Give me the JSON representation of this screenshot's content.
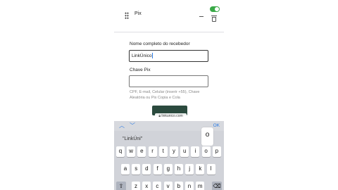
{
  "app": {
    "section_title": "Pix",
    "toggle_on": true,
    "accent_color": "#39a947"
  },
  "form": {
    "name_label": "Nome completo do recebedor",
    "name_value": "LinkÚnico",
    "key_label": "Chave Pix",
    "key_value": "",
    "hint": "CPF, E-mail, Celular (inserir +55), Chave Aleatória ou Pix Copia e Cola",
    "url": "linkunico.com"
  },
  "toolbar": {
    "up_icon": "chevron-up-icon",
    "down_icon": "chevron-down-icon",
    "done_label": "OK",
    "accent_color": "#2a7be4"
  },
  "keyboard": {
    "suggestion": "\"LinkÚni\"",
    "popup_key": "o",
    "row1": [
      "q",
      "w",
      "e",
      "r",
      "t",
      "y",
      "u",
      "i",
      "o",
      "p"
    ],
    "row2": [
      "a",
      "s",
      "d",
      "f",
      "g",
      "h",
      "j",
      "k",
      "l"
    ],
    "row3": [
      "z",
      "x",
      "c",
      "v",
      "b",
      "n",
      "m"
    ],
    "shift_icon": "shift-icon",
    "backspace_icon": "backspace-icon"
  }
}
